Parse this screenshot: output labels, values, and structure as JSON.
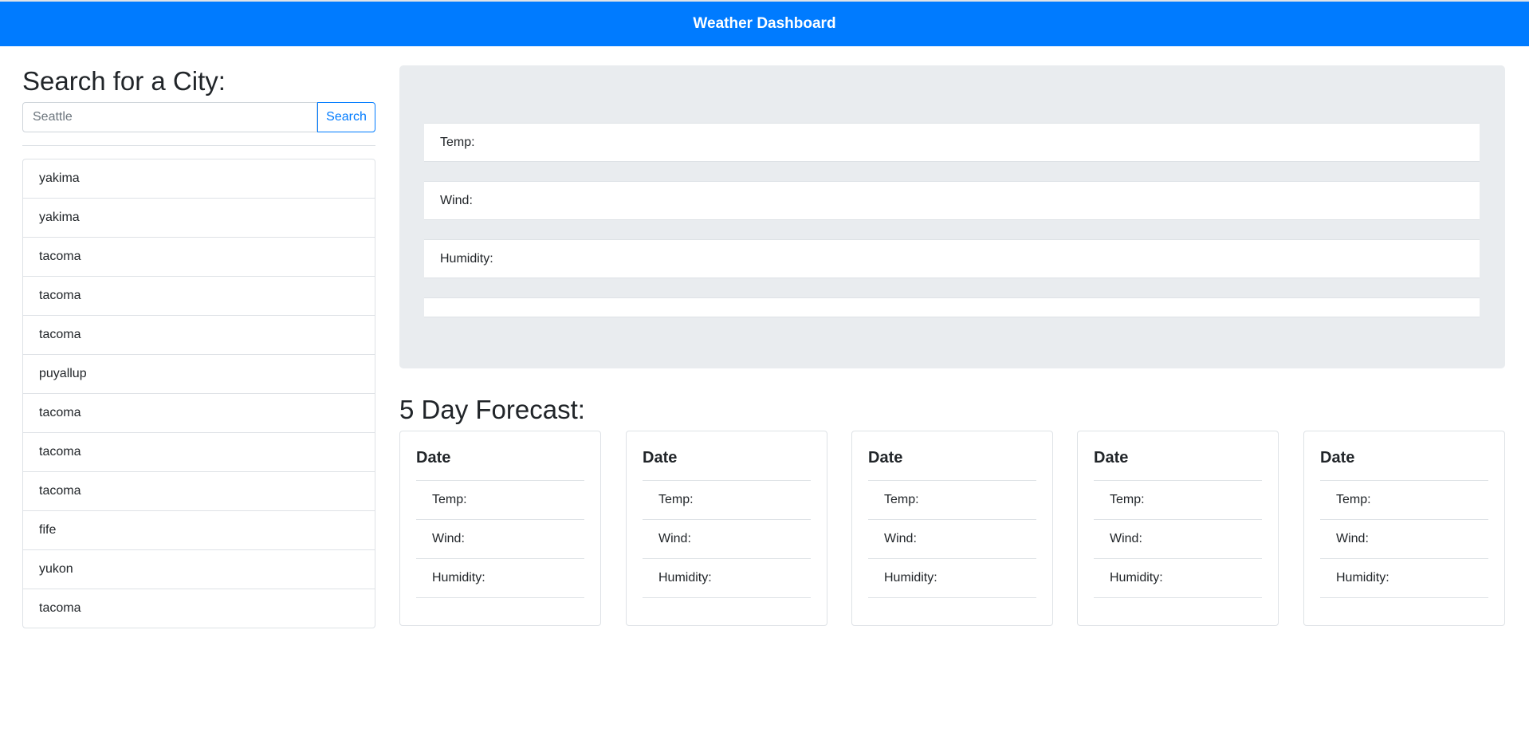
{
  "header": {
    "title": "Weather Dashboard"
  },
  "search": {
    "heading": "Search for a City:",
    "placeholder": "Seattle",
    "button_label": "Search"
  },
  "history": [
    "yakima",
    "yakima",
    "tacoma",
    "tacoma",
    "tacoma",
    "puyallup",
    "tacoma",
    "tacoma",
    "tacoma",
    "fife",
    "yukon",
    "tacoma"
  ],
  "current": {
    "temp_label": "Temp:",
    "wind_label": "Wind:",
    "humidity_label": "Humidity:"
  },
  "forecast": {
    "heading": "5 Day Forecast:",
    "cards": [
      {
        "date": "Date",
        "temp": "Temp:",
        "wind": "Wind:",
        "humidity": "Humidity:"
      },
      {
        "date": "Date",
        "temp": "Temp:",
        "wind": "Wind:",
        "humidity": "Humidity:"
      },
      {
        "date": "Date",
        "temp": "Temp:",
        "wind": "Wind:",
        "humidity": "Humidity:"
      },
      {
        "date": "Date",
        "temp": "Temp:",
        "wind": "Wind:",
        "humidity": "Humidity:"
      },
      {
        "date": "Date",
        "temp": "Temp:",
        "wind": "Wind:",
        "humidity": "Humidity:"
      }
    ]
  },
  "colors": {
    "brand": "#007bff",
    "panel": "#e9ecef"
  }
}
